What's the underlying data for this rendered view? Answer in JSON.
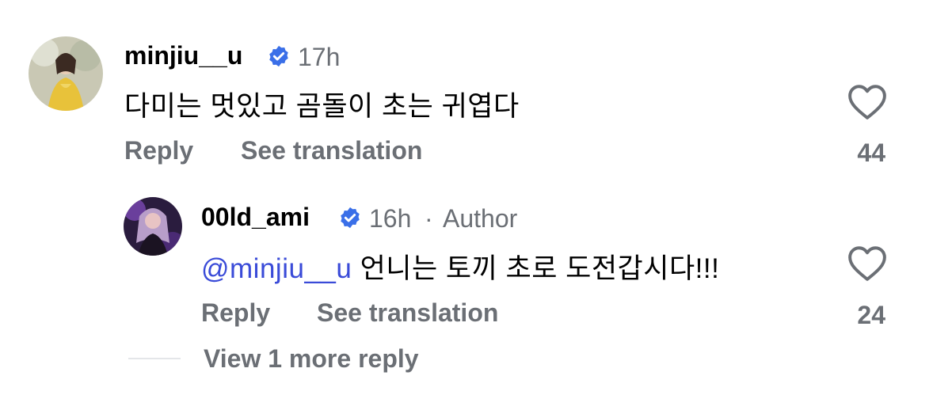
{
  "comment": {
    "username": "minjiu__u",
    "verified_icon": "verified-badge-icon",
    "time": "17h",
    "text": "다미는 멋있고 곰돌이 초는 귀엽다",
    "reply_label": "Reply",
    "translate_label": "See translation",
    "like_icon": "heart-icon",
    "like_count": "44",
    "accent_color": "#3a6fe8"
  },
  "reply": {
    "username": "00ld_ami",
    "verified_icon": "verified-badge-icon",
    "time": "16h",
    "separator": "·",
    "author_label": "Author",
    "mention": "@minjiu__u",
    "text": " 언니는 토끼 초로 도전갑시다!!!",
    "reply_label": "Reply",
    "translate_label": "See translation",
    "like_icon": "heart-icon",
    "like_count": "24"
  },
  "more_replies": {
    "label": "View 1 more reply"
  }
}
